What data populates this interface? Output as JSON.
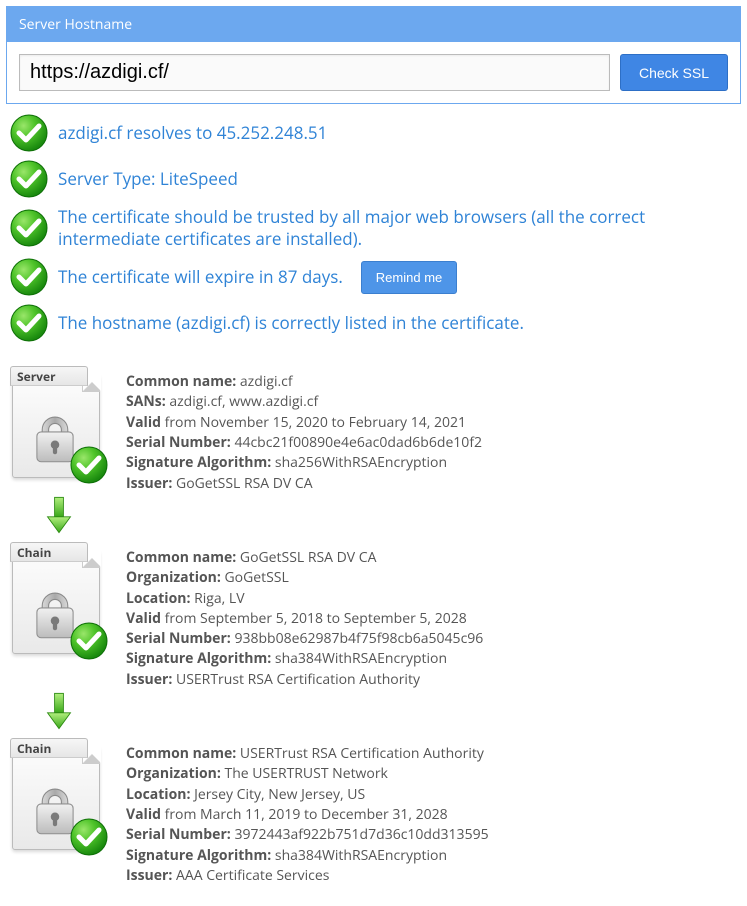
{
  "panel": {
    "title": "Server Hostname",
    "url": "https://azdigi.cf/",
    "check_label": "Check SSL"
  },
  "results": {
    "r1": "azdigi.cf resolves to 45.252.248.51",
    "r2": "Server Type: LiteSpeed",
    "r3": "The certificate should be trusted by all major web browsers (all the correct intermediate certificates are installed).",
    "r4": "The certificate will expire in 87 days.",
    "remind_label": "Remind me",
    "r5": "The hostname (azdigi.cf) is correctly listed in the certificate."
  },
  "labels": {
    "common_name": "Common name:",
    "sans": "SANs:",
    "valid": "Valid",
    "serial": "Serial Number:",
    "sigalg": "Signature Algorithm:",
    "issuer": "Issuer:",
    "org": "Organization:",
    "loc": "Location:"
  },
  "certs": {
    "server": {
      "tag": "Server",
      "common_name": "azdigi.cf",
      "sans": "azdigi.cf, www.azdigi.cf",
      "valid": " from November 15, 2020 to February 14, 2021",
      "serial": "44cbc21f00890e4e6ac0dad6b6de10f2",
      "sigalg": "sha256WithRSAEncryption",
      "issuer": "GoGetSSL RSA DV CA"
    },
    "chain1": {
      "tag": "Chain",
      "common_name": "GoGetSSL RSA DV CA",
      "org": "GoGetSSL",
      "loc": "Riga, LV",
      "valid": " from September 5, 2018 to September 5, 2028",
      "serial": "938bb08e62987b4f75f98cb6a5045c96",
      "sigalg": "sha384WithRSAEncryption",
      "issuer": "USERTrust RSA Certification Authority"
    },
    "chain2": {
      "tag": "Chain",
      "common_name": "USERTrust RSA Certification Authority",
      "org": "The USERTRUST Network",
      "loc": "Jersey City, New Jersey, US",
      "valid": " from March 11, 2019 to December 31, 2028",
      "serial": "3972443af922b751d7d36c10dd313595",
      "sigalg": "sha384WithRSAEncryption",
      "issuer": "AAA Certificate Services"
    }
  }
}
